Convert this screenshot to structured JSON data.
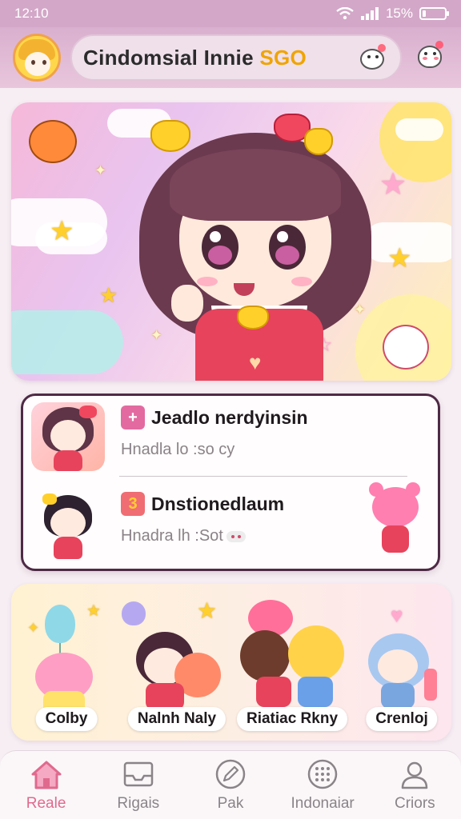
{
  "status_bar": {
    "time": "12:10",
    "battery_text": "15%",
    "battery_level": 0.15,
    "icons": [
      "wifi-icon",
      "signal-icon",
      "battery-icon"
    ]
  },
  "header": {
    "title_main": "Cindomsial Innie",
    "title_accent": "SGO",
    "avatar": "avatar-icon",
    "left_mascot": "mascot-icon",
    "right_mascot": "menu-mascot-icon",
    "accent_color": "#f0a400"
  },
  "hero": {
    "icons": [
      "hero-girl-illustration",
      "star-icon",
      "cloud-icon",
      "sun-icon"
    ]
  },
  "list": {
    "items": [
      {
        "badge": "+",
        "badge_color": "#e36aa0",
        "title": "Jeadlo nerdyinsin",
        "subtitle": "Hnadla lo :so cy"
      },
      {
        "badge": "3",
        "badge_color": "#ef6d73",
        "title": "Dnstionedlaum",
        "subtitle": "Hnadra lh :Sot"
      }
    ]
  },
  "characters": [
    {
      "label": "Colby"
    },
    {
      "label": "Nalnh Naly"
    },
    {
      "label": "Riatiac Rkny"
    },
    {
      "label": "Crenloj"
    }
  ],
  "bottom_nav": {
    "items": [
      {
        "label": "Reale",
        "icon": "home-icon",
        "active": true
      },
      {
        "label": "Rigais",
        "icon": "inbox-icon",
        "active": false
      },
      {
        "label": "Pak",
        "icon": "pencil-icon",
        "active": false
      },
      {
        "label": "Indonaiar",
        "icon": "grid-dots-icon",
        "active": false
      },
      {
        "label": "Criors",
        "icon": "profile-icon",
        "active": false
      }
    ],
    "active_color": "#e06a8e"
  }
}
